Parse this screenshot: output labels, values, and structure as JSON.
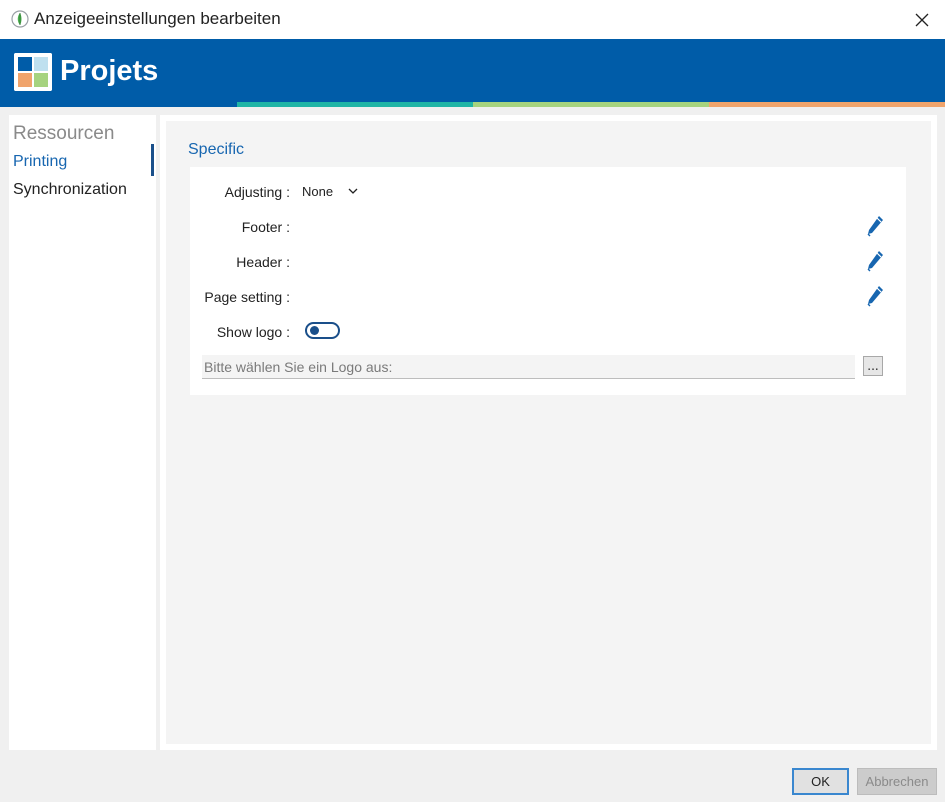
{
  "window": {
    "title": "Anzeigeeinstellungen bearbeiten"
  },
  "banner": {
    "app_name": "Projets"
  },
  "sidebar": {
    "group": "Ressourcen",
    "items": [
      {
        "label": "Printing",
        "active": true
      },
      {
        "label": "Synchronization",
        "active": false
      }
    ]
  },
  "section": {
    "title": "Specific",
    "adjusting": {
      "label": "Adjusting :",
      "value": "None"
    },
    "footer": {
      "label": "Footer :"
    },
    "header": {
      "label": "Header :"
    },
    "page_setting": {
      "label": "Page setting :"
    },
    "show_logo": {
      "label": "Show logo :",
      "enabled": false
    },
    "logo_field": {
      "placeholder": "Bitte wählen Sie ein Logo aus:",
      "value": "",
      "browse_label": "..."
    }
  },
  "buttons": {
    "ok": "OK",
    "cancel": "Abbrechen"
  },
  "colors": {
    "accent": "#005ca8",
    "stripe": [
      "#005ca8",
      "#1fb5a6",
      "#a6d37f",
      "#f0a46c"
    ]
  }
}
